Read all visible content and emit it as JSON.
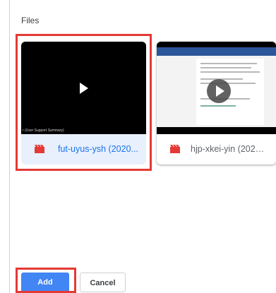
{
  "dialog": {
    "section_title": "Files"
  },
  "files": [
    {
      "name": "fut-uyus-ysh (2020...",
      "thumbnail_caption": "r (User Support Summary)",
      "selected": true,
      "icon": "video-file-icon"
    },
    {
      "name": "hjp-xkei-yin (2020-...",
      "selected": false,
      "icon": "video-file-icon"
    }
  ],
  "actions": {
    "add_label": "Add",
    "cancel_label": "Cancel"
  },
  "colors": {
    "accent": "#4285f4",
    "selected_bg": "#e8f0fe",
    "selected_text": "#1a73e8",
    "file_icon": "#e53935",
    "highlight": "#e53935"
  }
}
